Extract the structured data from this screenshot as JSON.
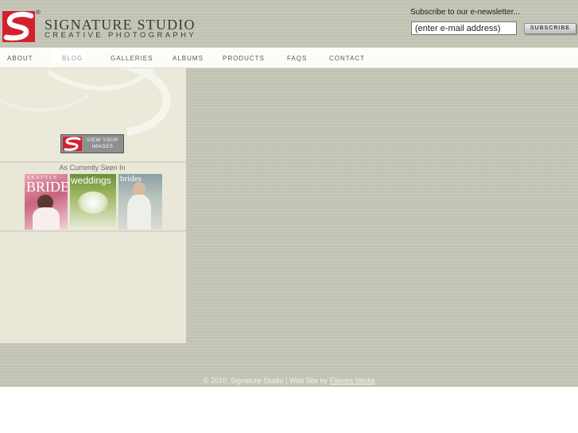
{
  "header": {
    "brand_name": "SIGNATURE STUDIO",
    "brand_tagline": "CREATIVE PHOTOGRAPHY",
    "registered_mark": "®",
    "logo_letter": "S",
    "newsletter_label": "Subscribe to our e-newsletter...",
    "email_placeholder": "(enter e-mail address)",
    "subscribe_label": "SUBSCRIBE"
  },
  "nav": {
    "items": [
      {
        "label": "ABOUT"
      },
      {
        "label": "BLOG"
      },
      {
        "label": "GALLERIES"
      },
      {
        "label": "ALBUMS"
      },
      {
        "label": "PRODUCTS"
      },
      {
        "label": "FAQS"
      },
      {
        "label": "CONTACT"
      }
    ]
  },
  "sidebar": {
    "view_images_line1": "VIEW YOUR",
    "view_images_line2": "IMAGES",
    "seen_in_label": "As Currently Seen In",
    "magazines": [
      {
        "title": "SEATTLE BRIDE",
        "line1": "SEATTLE",
        "line2": "BRIDE"
      },
      {
        "title": "weddings"
      },
      {
        "title": "brides"
      }
    ]
  },
  "footer": {
    "copyright": "© 2010, Signature Studio  |   Web Site by ",
    "credit_link": "Flavors Media"
  },
  "colors": {
    "brand_red": "#d3202e",
    "header_bg": "#c3c3b5",
    "sidebar_bg": "#e9e7d7",
    "nav_bg": "#fdfdf8"
  }
}
